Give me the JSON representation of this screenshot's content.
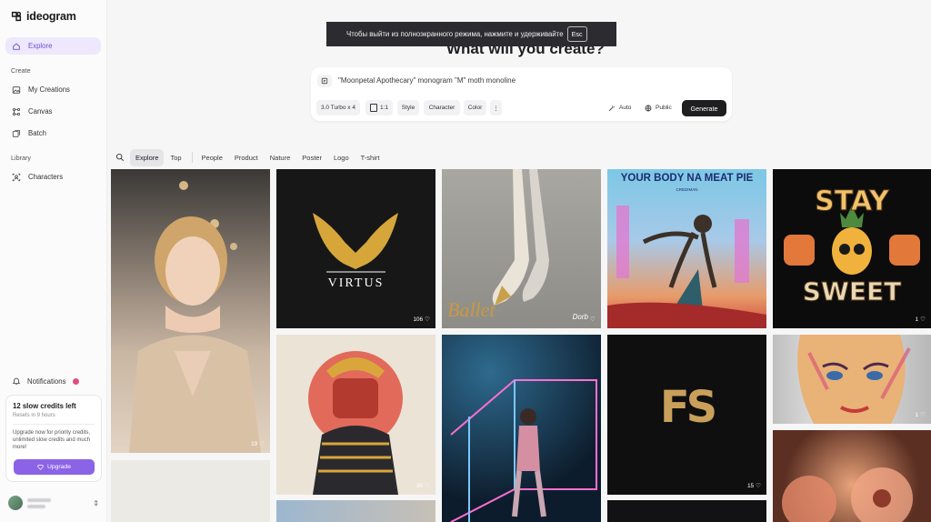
{
  "app": {
    "name": "ideogram"
  },
  "sidebar": {
    "explore": "Explore",
    "create_label": "Create",
    "my_creations": "My Creations",
    "canvas": "Canvas",
    "batch": "Batch",
    "library_label": "Library",
    "characters": "Characters",
    "notifications": "Notifications"
  },
  "credits": {
    "title": "12 slow credits left",
    "resets": "Resets in 9 hours",
    "upsell": "Upgrade now for priority credits, unlimited slow credits and much more!",
    "upgrade": "Upgrade"
  },
  "toast": {
    "text": "Чтобы выйти из полноэкранного режима, нажмите и удерживайте",
    "key": "Esc"
  },
  "hero": {
    "title": "What will you create?"
  },
  "prompt": {
    "text": "\"Moonpetal Apothecary\" monogram \"M\" moth monoline",
    "model": "3.0 Turbo x 4",
    "ratio": "1:1",
    "style": "Style",
    "character": "Character",
    "color": "Color",
    "more": "⋮",
    "auto": "Auto",
    "visibility": "Public",
    "generate": "Generate"
  },
  "filters": [
    "Explore",
    "Top",
    "People",
    "Product",
    "Nature",
    "Poster",
    "Logo",
    "T-shirt"
  ],
  "tiles": {
    "woman": {
      "likes": "19"
    },
    "virtus": {
      "text": "VIRTUS",
      "likes": "106"
    },
    "ballet": {
      "text": "Ballet",
      "sign": "Dorb"
    },
    "poster": {
      "title": "YOUR BODY NA MEAT PIE",
      "sub": "CREDIMAN"
    },
    "stay": {
      "line1": "STAY",
      "line2": "SWEET",
      "likes": "1"
    },
    "samurai": {
      "likes": "30"
    },
    "fs": {
      "text": "FS",
      "likes": "15"
    },
    "face": {
      "likes": "1"
    }
  },
  "colors": {
    "accent": "#8b63e6",
    "active_bg": "#ede8fb",
    "generate_bg": "#1f1f22"
  }
}
